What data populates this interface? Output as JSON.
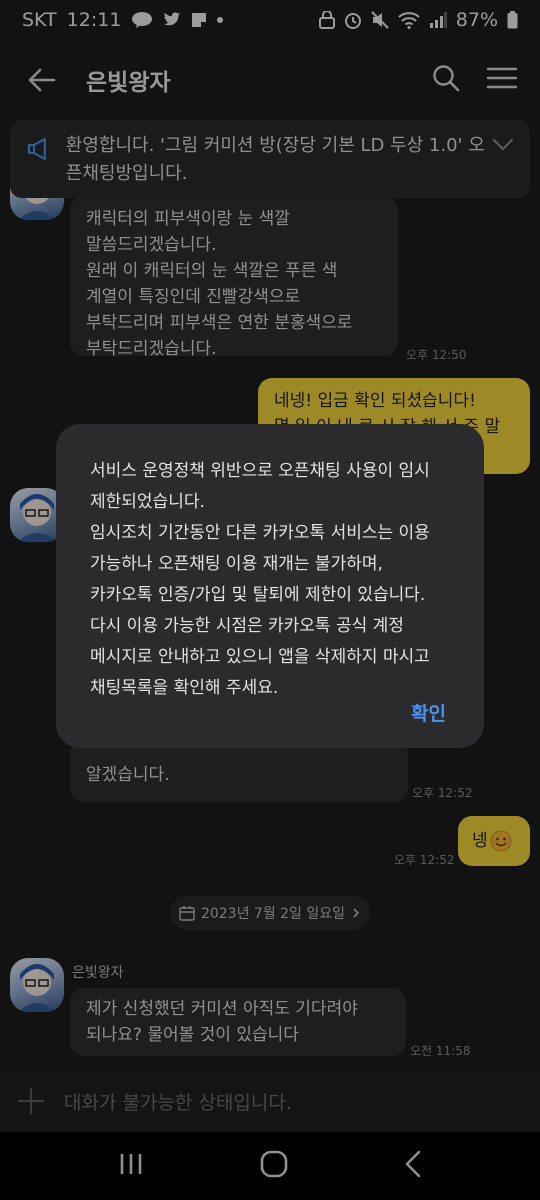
{
  "status_bar": {
    "carrier": "SKT",
    "time": "12:11",
    "talk_badge": "TALK",
    "battery": "87%"
  },
  "header": {
    "title": "은빛왕자"
  },
  "notice": {
    "text": "환영합니다. '그림 커미션 방(장당 기본 LD 두상 1.0' 오픈채팅방입니다."
  },
  "messages": {
    "m1": {
      "text": "캐릭터의 피부색이랑 눈 색깔\n말씀드리겠습니다.\n원래 이 캐릭터의 눈 색깔은 푸른 색\n계열이 특징인데 진빨강색으로\n부탁드리며 피부색은 연한 분홍색으로\n부탁드리겠습니다.",
      "time": "오후 12:50"
    },
    "m2": {
      "text": "네넹! 입금 확인 되셨습니다!\n몇 일 이 내 로 시 작 해 서 주 말 쯤 에",
      "time": ""
    },
    "m3": {
      "text": "알겠습니다.",
      "time": "오후 12:52"
    },
    "m4": {
      "text": "넹",
      "time": "오후 12:52"
    },
    "date_divider": "2023년 7월 2일 일요일",
    "m5": {
      "sender": "은빛왕자",
      "text": "제가 신청했던 커미션 아직도 기다려야\n되나요? 물어볼 것이 있습니다",
      "time": "오전 11:58"
    }
  },
  "input": {
    "placeholder": "대화가 불가능한 상태입니다."
  },
  "dialog": {
    "message": "서비스 운영정책 위반으로 오픈채팅 사용이 임시\n제한되었습니다.\n임시조치 기간동안 다른 카카오톡 서비스는 이용\n가능하나 오픈채팅 이용 재개는 불가하며,\n카카오톡 인증/가입 및 탈퇴에 제한이 있습니다.\n다시 이용 가능한 시점은 카카오톡 공식 계정\n메시지로 안내하고 있으니 앱을 삭제하지 마시고\n채팅목록을 확인해 주세요.",
    "ok_label": "확인"
  },
  "icons": {
    "back": "arrow-left-icon",
    "search": "search-icon",
    "menu": "hamburger-menu-icon",
    "notice": "megaphone-icon",
    "calendar": "calendar-icon",
    "add": "plus-icon",
    "recents": "recent-apps-icon",
    "home": "home-icon",
    "nav_back": "nav-back-icon"
  },
  "colors": {
    "background": "#1c1c1c",
    "my_bubble": "#f3d33c",
    "their_bubble": "#2f2f31",
    "dialog_button": "#4b94f2"
  }
}
